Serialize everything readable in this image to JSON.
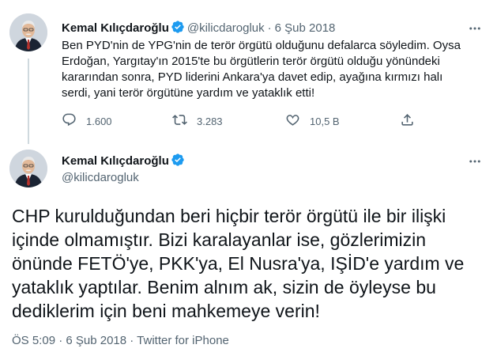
{
  "colors": {
    "accent": "#1d9bf0",
    "text": "#0f1419",
    "muted": "#536471"
  },
  "reply_tweet": {
    "author_name": "Kemal Kılıçdaroğlu",
    "verified_icon": "verified-badge-icon",
    "handle": "@kilicdarogluk",
    "separator": "·",
    "date": "6 Şub 2018",
    "more_icon": "more-options-icon",
    "text": "Ben PYD'nin de YPG'nin de terör örgütü olduğunu defalarca söyledim. Oysa Erdoğan, Yargıtay'ın 2015'te bu örgütlerin terör örgütü olduğu yönündeki kararından sonra, PYD liderini Ankara'ya davet edip, ayağına kırmızı halı serdi, yani terör örgütüne yardım ve yataklık etti!",
    "actions": {
      "reply": {
        "icon": "reply-icon",
        "count": "1.600"
      },
      "retweet": {
        "icon": "retweet-icon",
        "count": "3.283"
      },
      "like": {
        "icon": "like-icon",
        "count": "10,5 B"
      },
      "share": {
        "icon": "share-icon"
      }
    }
  },
  "main_tweet": {
    "author_name": "Kemal Kılıçdaroğlu",
    "verified_icon": "verified-badge-icon",
    "handle": "@kilicdarogluk",
    "more_icon": "more-options-icon",
    "text": "CHP kurulduğundan beri hiçbir terör örgütü ile bir ilişki içinde olmamıştır. Bizi karalayanlar ise, gözlerimizin önünde FETÖ'ye, PKK'ya, El Nusra'ya, IŞİD'e yardım ve yataklık yaptılar. Benim alnım ak, sizin de öyleyse bu dediklerim için beni mahkemeye verin!",
    "meta": "ÖS 5:09 · 6 Şub 2018 · Twitter for iPhone"
  }
}
